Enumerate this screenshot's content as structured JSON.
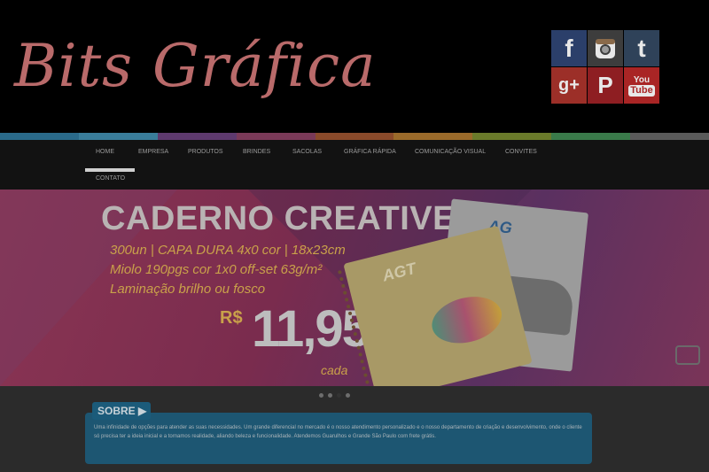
{
  "brand": {
    "name": "Bits Gráfica"
  },
  "social": [
    {
      "name": "facebook-icon",
      "glyph": "f"
    },
    {
      "name": "instagram-icon",
      "glyph": ""
    },
    {
      "name": "tumblr-icon",
      "glyph": "t"
    },
    {
      "name": "google-plus-icon",
      "glyph": "g+"
    },
    {
      "name": "pinterest-icon",
      "glyph": "P"
    },
    {
      "name": "youtube-icon",
      "top": "You",
      "bottom": "Tube"
    }
  ],
  "nav": {
    "items": [
      "HOME",
      "EMPRESA",
      "PRODUTOS",
      "BRINDES",
      "SACOLAS",
      "GRÁFICA RÁPIDA",
      "COMUNICAÇÃO VISUAL",
      "CONVITES",
      "CONTATO"
    ]
  },
  "banner": {
    "title": "CADERNO CREATIVE",
    "line1": "300un | CAPA DURA 4x0 cor | 18x23cm",
    "line2": "Miolo 190pgs cor 1x0 off-set 63g/m²",
    "line3": "Laminação brilho ou fosco",
    "currency": "R$",
    "price": "11,95",
    "per": "cada",
    "book_logo": "AGT",
    "book2_logo": "AG"
  },
  "about": {
    "tab": "SOBRE ▶",
    "text": "Uma infinidade de opções para atender as suas necessidades. Um grande diferencial no mercado é o nosso atendimento personalizado e o nosso departamento de criação e desenvolvimento, onde o cliente só precisa ter a ideia inicial e a tornamos realidade, aliando beleza e funcionalidade. Atendemos Guarulhos e Grande São Paulo com frete grátis."
  },
  "colors": {
    "brand": "#b96a6a",
    "stripe": [
      "#2a6a8a",
      "#3a7d9a",
      "#5e3a6e",
      "#7a3a58",
      "#8a4a2a",
      "#9a6a2a",
      "#6a7a2a",
      "#3a7a4a",
      "#5a5a5a"
    ]
  }
}
